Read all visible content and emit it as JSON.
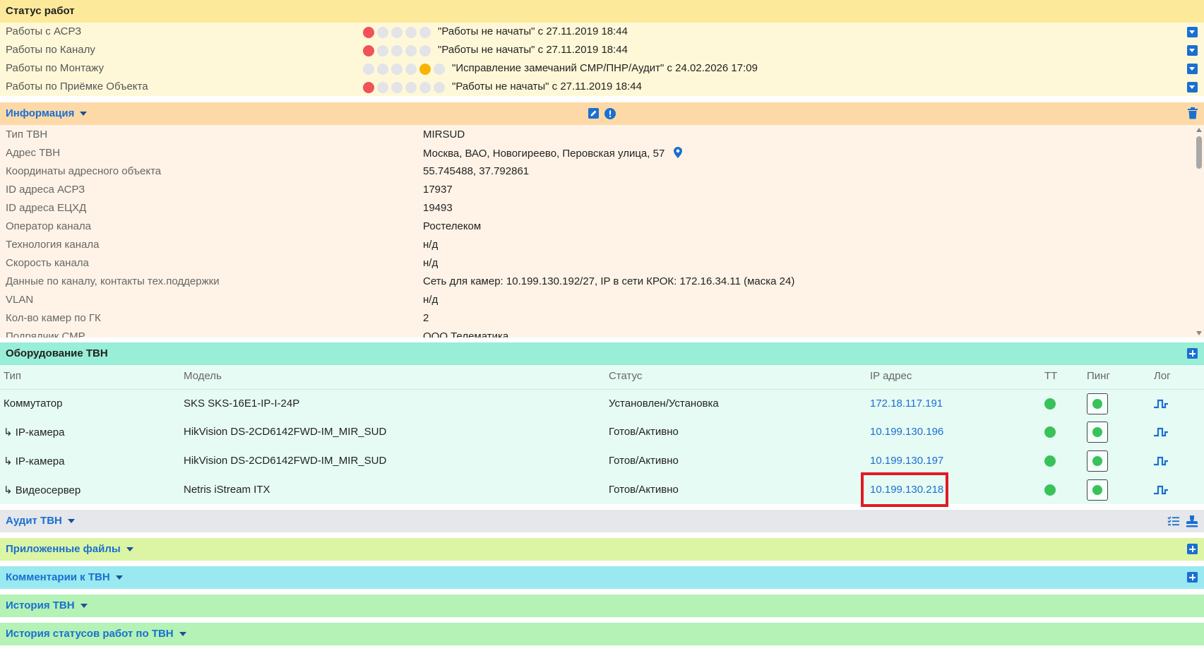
{
  "status": {
    "title": "Статус работ",
    "rows": [
      {
        "label": "Работы с АСРЗ",
        "text": "\"Работы не начаты\" с 27.11.2019 18:44"
      },
      {
        "label": "Работы по Каналу",
        "text": "\"Работы не начаты\" с 27.11.2019 18:44"
      },
      {
        "label": "Работы по Монтажу",
        "text": "\"Исправление замечаний СМР/ПНР/Аудит\" с 24.02.2026 17:09"
      },
      {
        "label": "Работы по Приёмке Объекта",
        "text": "\"Работы не начаты\" с 27.11.2019 18:44"
      }
    ]
  },
  "info": {
    "title": "Информация",
    "rows": [
      {
        "key": "Тип ТВН",
        "value": "MIRSUD"
      },
      {
        "key": "Адрес ТВН",
        "value": "Москва, ВАО, Новогиреево, Перовская улица, 57"
      },
      {
        "key": "Координаты адресного объекта",
        "value": "55.745488, 37.792861"
      },
      {
        "key": "ID адреса АСРЗ",
        "value": "17937"
      },
      {
        "key": "ID адреса ЕЦХД",
        "value": "19493"
      },
      {
        "key": "Оператор канала",
        "value": "Ростелеком"
      },
      {
        "key": "Технология канала",
        "value": "н/д"
      },
      {
        "key": "Скорость канала",
        "value": "н/д"
      },
      {
        "key": "Данные по каналу, контакты тех.поддержки",
        "value": "Сеть для камер: 10.199.130.192/27, IP в сети КРОК: 172.16.34.11 (маска 24)"
      },
      {
        "key": "VLAN",
        "value": "н/д"
      },
      {
        "key": "Кол-во камер по ГК",
        "value": "2"
      },
      {
        "key": "Подрядчик СМР",
        "value": "ООО Телематика"
      }
    ]
  },
  "equipment": {
    "title": "Оборудование ТВН",
    "columns": {
      "type": "Тип",
      "model": "Модель",
      "status": "Статус",
      "ip": "IP адрес",
      "tt": "ТТ",
      "ping": "Пинг",
      "log": "Лог"
    },
    "rows": [
      {
        "type": "Коммутатор",
        "model": "SKS SKS-16E1-IP-I-24P",
        "status": "Установлен/Установка",
        "ip": "172.18.117.191"
      },
      {
        "type": "↳ IP-камера",
        "model": "HikVision DS-2CD6142FWD-IM_MIR_SUD",
        "status": "Готов/Активно",
        "ip": "10.199.130.196"
      },
      {
        "type": "↳ IP-камера",
        "model": "HikVision DS-2CD6142FWD-IM_MIR_SUD",
        "status": "Готов/Активно",
        "ip": "10.199.130.197"
      },
      {
        "type": "↳ Видеосервер",
        "model": "Netris iStream ITX",
        "status": "Готов/Активно",
        "ip": "10.199.130.218"
      }
    ]
  },
  "sections": {
    "audit": "Аудит ТВН",
    "files": "Приложенные файлы",
    "comments": "Комментарии к ТВН",
    "history": "История ТВН",
    "status_history": "История статусов работ по ТВН"
  },
  "colors": {
    "accent": "#1a6fd1",
    "ok": "#3ac25a",
    "error": "#f0525a",
    "warning": "#f6b400",
    "highlight": "#e01b24"
  }
}
